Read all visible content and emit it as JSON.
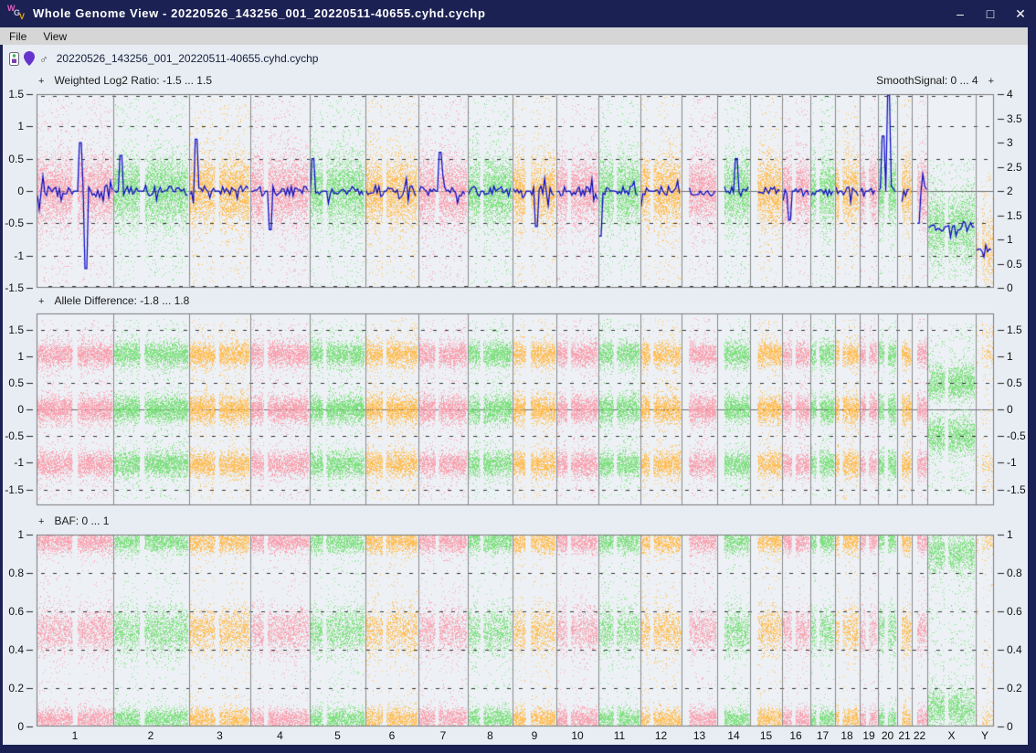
{
  "window": {
    "title": "Whole Genome View - 20220526_143256_001_20220511-40655.cyhd.cychp",
    "icon_letters": [
      "W",
      "G",
      "V"
    ],
    "controls": {
      "minimize": "–",
      "maximize": "□",
      "close": "✕"
    }
  },
  "menu": {
    "items": [
      "File",
      "View"
    ]
  },
  "sample": {
    "sex_symbol": "♂",
    "filename": "20220526_143256_001_20220511-40655.cyhd.cychp"
  },
  "symbols": {
    "plus": "+"
  },
  "colors": {
    "pink": "#f8a2b0",
    "green": "#7de07d",
    "orange": "#ffbe55",
    "signal_line": "#0b0bc4",
    "titlebar": "#1b2153",
    "menubar": "#d6d6d6",
    "content_bg": "#e8edf3",
    "plot_bg": "#edf1f6",
    "border": "#7a7a7a",
    "grid": "#222222"
  },
  "colors_cycle": [
    "pink",
    "green",
    "orange"
  ],
  "chromosomes": [
    {
      "name": "1",
      "length_mb": 249,
      "centromere": 0.5
    },
    {
      "name": "2",
      "length_mb": 243,
      "centromere": 0.38
    },
    {
      "name": "3",
      "length_mb": 198,
      "centromere": 0.46
    },
    {
      "name": "4",
      "length_mb": 191,
      "centromere": 0.26
    },
    {
      "name": "5",
      "length_mb": 181,
      "centromere": 0.27
    },
    {
      "name": "6",
      "length_mb": 171,
      "centromere": 0.36
    },
    {
      "name": "7",
      "length_mb": 159,
      "centromere": 0.38
    },
    {
      "name": "8",
      "length_mb": 146,
      "centromere": 0.31
    },
    {
      "name": "9",
      "length_mb": 141,
      "centromere": 0.35,
      "gap_extra": 0.03
    },
    {
      "name": "10",
      "length_mb": 136,
      "centromere": 0.3
    },
    {
      "name": "11",
      "length_mb": 135,
      "centromere": 0.4
    },
    {
      "name": "12",
      "length_mb": 134,
      "centromere": 0.27
    },
    {
      "name": "13",
      "length_mb": 115,
      "centromere": 0.17,
      "acrocentric": true
    },
    {
      "name": "14",
      "length_mb": 107,
      "centromere": 0.17,
      "acrocentric": true
    },
    {
      "name": "15",
      "length_mb": 103,
      "centromere": 0.19,
      "acrocentric": true
    },
    {
      "name": "16",
      "length_mb": 90,
      "centromere": 0.41
    },
    {
      "name": "17",
      "length_mb": 81,
      "centromere": 0.3
    },
    {
      "name": "18",
      "length_mb": 78,
      "centromere": 0.22
    },
    {
      "name": "19",
      "length_mb": 59,
      "centromere": 0.44
    },
    {
      "name": "20",
      "length_mb": 63,
      "centromere": 0.44
    },
    {
      "name": "21",
      "length_mb": 48,
      "centromere": 0.27,
      "acrocentric": true
    },
    {
      "name": "22",
      "length_mb": 51,
      "centromere": 0.29,
      "acrocentric": true
    },
    {
      "name": "X",
      "length_mb": 155,
      "centromere": 0.39,
      "cls": "X"
    },
    {
      "name": "Y",
      "length_mb": 59,
      "centromere": 0.21,
      "cls": "Y"
    }
  ],
  "chart_data": [
    {
      "name": "weighted-log2-ratio",
      "type": "scatter",
      "title": "Weighted Log2 Ratio: -1.5 ... 1.5",
      "right_title": "SmoothSignal: 0 ... 4",
      "y_min": -1.5,
      "y_max": 1.5,
      "right_min": 0,
      "right_max": 4,
      "left_ticks": [
        [
          "1.5",
          1.5
        ],
        [
          "1",
          1
        ],
        [
          "0.5",
          0.5
        ],
        [
          "0",
          0
        ],
        [
          "-0.5",
          -0.5
        ],
        [
          "-1",
          -1
        ],
        [
          "-1.5",
          -1.5
        ]
      ],
      "right_ticks": [
        [
          "4",
          4
        ],
        [
          "3.5",
          3.5
        ],
        [
          "3",
          3
        ],
        [
          "2.5",
          2.5
        ],
        [
          "2",
          2
        ],
        [
          "1.5",
          1.5
        ],
        [
          "1",
          1
        ],
        [
          "0.5",
          0.5
        ],
        [
          "0",
          0
        ]
      ],
      "gridlines": [
        1.5,
        1,
        0.5,
        -0.5,
        -1,
        -1.5
      ],
      "zero_line": true,
      "dist": {
        "autosome": {
          "density": 55,
          "bands": [
            [
              0,
              0.27,
              0.86
            ]
          ],
          "uniform": [
            -1.45,
            1.45
          ]
        },
        "X": {
          "density": 48,
          "bands": [
            [
              -0.55,
              0.28,
              0.85
            ]
          ],
          "uniform": [
            -1.4,
            0.5
          ]
        },
        "Y": {
          "density": 30,
          "bands": [
            [
              -0.9,
              0.3,
              0.8
            ]
          ],
          "uniform": [
            -1.4,
            0.3
          ]
        }
      },
      "smooth_line": {
        "noise": 0.08,
        "burst": 0.22,
        "means": {
          "autosome": 0,
          "X": -0.55,
          "Y": -0.9
        },
        "spikes": [
          {
            "chrom": "1",
            "frac": 0.56,
            "value": 0.75
          },
          {
            "chrom": "1",
            "frac": 0.63,
            "value": -1.2
          },
          {
            "chrom": "2",
            "frac": 0.1,
            "value": 0.55
          },
          {
            "chrom": "3",
            "frac": 0.12,
            "value": 0.8
          },
          {
            "chrom": "4",
            "frac": 0.33,
            "value": -0.6
          },
          {
            "chrom": "5",
            "frac": 0.05,
            "value": 0.5
          },
          {
            "chrom": "7",
            "frac": 0.44,
            "value": 0.6
          },
          {
            "chrom": "9",
            "frac": 0.55,
            "value": -0.55
          },
          {
            "chrom": "11",
            "frac": 0.05,
            "value": -0.7
          },
          {
            "chrom": "14",
            "frac": 0.6,
            "value": 0.5
          },
          {
            "chrom": "16",
            "frac": 0.25,
            "value": -0.45
          },
          {
            "chrom": "20",
            "frac": 0.56,
            "value": 1.5
          },
          {
            "chrom": "20",
            "frac": 0.3,
            "value": 0.85
          },
          {
            "chrom": "22",
            "frac": 0.45,
            "value": -0.5
          }
        ]
      }
    },
    {
      "name": "allele-difference",
      "type": "scatter",
      "title": "Allele Difference: -1.8 ... 1.8",
      "y_min": -1.8,
      "y_max": 1.8,
      "right_min": -1.8,
      "right_max": 1.8,
      "left_ticks": [
        [
          "1.5",
          1.5
        ],
        [
          "1",
          1
        ],
        [
          "0.5",
          0.5
        ],
        [
          "0",
          0
        ],
        [
          "-0.5",
          -0.5
        ],
        [
          "-1",
          -1
        ],
        [
          "-1.5",
          -1.5
        ]
      ],
      "right_ticks": [
        [
          "1.5",
          1.5
        ],
        [
          "1",
          1
        ],
        [
          "0.5",
          0.5
        ],
        [
          "0",
          0
        ],
        [
          "-0.5",
          -0.5
        ],
        [
          "-1",
          -1
        ],
        [
          "-1.5",
          -1.5
        ]
      ],
      "gridlines": [
        1.5,
        0.5,
        -0.5,
        -1.5
      ],
      "zero_line": true,
      "dist": {
        "autosome": {
          "density": 85,
          "bands": [
            [
              1.03,
              0.12,
              0.27
            ],
            [
              0,
              0.13,
              0.34
            ],
            [
              -1.03,
              0.12,
              0.27
            ]
          ],
          "uniform": [
            -1.7,
            1.7
          ]
        },
        "X": {
          "density": 70,
          "bands": [
            [
              0.5,
              0.17,
              0.42
            ],
            [
              -0.5,
              0.17,
              0.42
            ]
          ],
          "uniform": [
            -1.6,
            1.6
          ]
        },
        "Y": {
          "density": 22,
          "bands": [
            [
              1.02,
              0.1,
              0.26
            ],
            [
              -1.02,
              0.1,
              0.26
            ],
            [
              1.45,
              0.07,
              0.07
            ],
            [
              -1.45,
              0.07,
              0.07
            ]
          ],
          "uniform": [
            -1.65,
            1.65
          ]
        }
      }
    },
    {
      "name": "baf",
      "type": "scatter",
      "title": "BAF: 0 ... 1",
      "y_min": 0,
      "y_max": 1,
      "right_min": 0,
      "right_max": 1,
      "left_ticks": [
        [
          "1",
          1
        ],
        [
          "0.8",
          0.8
        ],
        [
          "0.6",
          0.6
        ],
        [
          "0.4",
          0.4
        ],
        [
          "0.2",
          0.2
        ],
        [
          "0",
          0
        ]
      ],
      "right_ticks": [
        [
          "1",
          1
        ],
        [
          "0.8",
          0.8
        ],
        [
          "0.6",
          0.6
        ],
        [
          "0.4",
          0.4
        ],
        [
          "0.2",
          0.2
        ],
        [
          "0",
          0
        ]
      ],
      "gridlines": [
        0.8,
        0.6,
        0.4,
        0.2
      ],
      "zero_line": false,
      "dist": {
        "autosome": {
          "density": 70,
          "bands": [
            [
              0.965,
              0.032,
              0.3
            ],
            [
              0.5,
              0.06,
              0.33
            ],
            [
              0.035,
              0.032,
              0.3
            ]
          ],
          "uniform": [
            0.03,
            0.97
          ]
        },
        "X": {
          "density": 60,
          "bands": [
            [
              0.91,
              0.055,
              0.42
            ],
            [
              0.09,
              0.055,
              0.42
            ]
          ],
          "uniform": [
            0.05,
            0.95
          ]
        },
        "Y": {
          "density": 20,
          "bands": [
            [
              0.96,
              0.035,
              0.38
            ],
            [
              0.04,
              0.035,
              0.38
            ]
          ],
          "uniform": [
            0.05,
            0.95
          ]
        }
      }
    }
  ]
}
